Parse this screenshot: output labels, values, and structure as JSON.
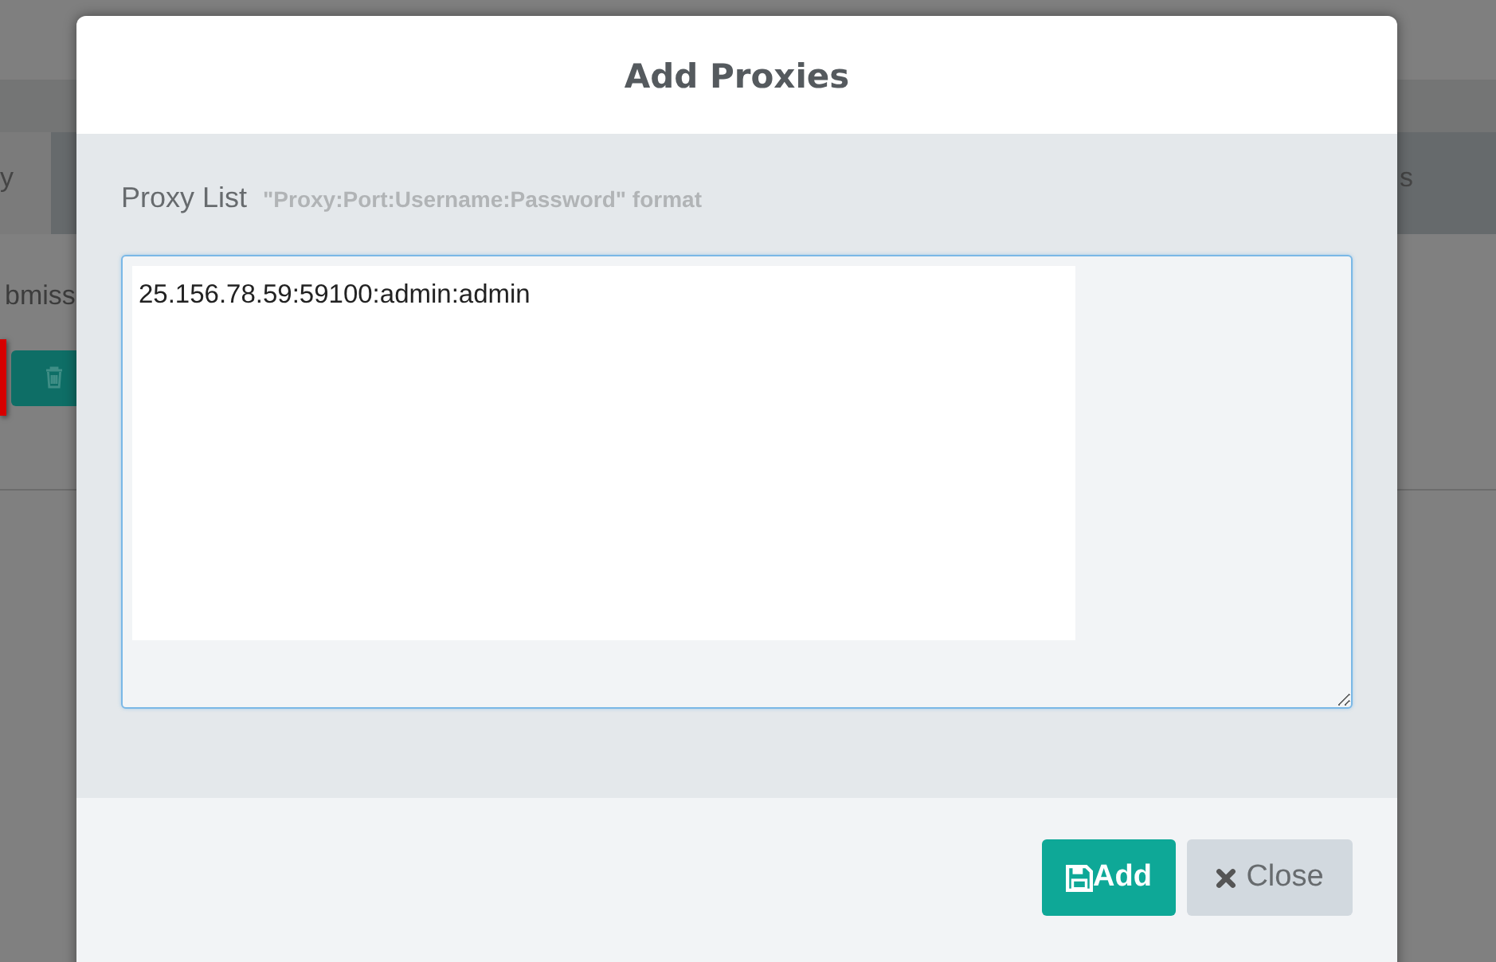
{
  "background": {
    "tabs": [
      {
        "label": "y",
        "selected": true
      },
      {
        "label": "s",
        "selected": false
      }
    ],
    "text": "bmiss"
  },
  "dialog": {
    "title": "Add Proxies",
    "field": {
      "label": "Proxy List",
      "hint": "\"Proxy:Port:Username:Password\" format",
      "value": "25.156.78.59:59100:admin:admin",
      "focused": true
    },
    "buttons": [
      {
        "kind": "save",
        "label": "Add"
      },
      {
        "kind": "close",
        "label": "Close"
      }
    ]
  }
}
